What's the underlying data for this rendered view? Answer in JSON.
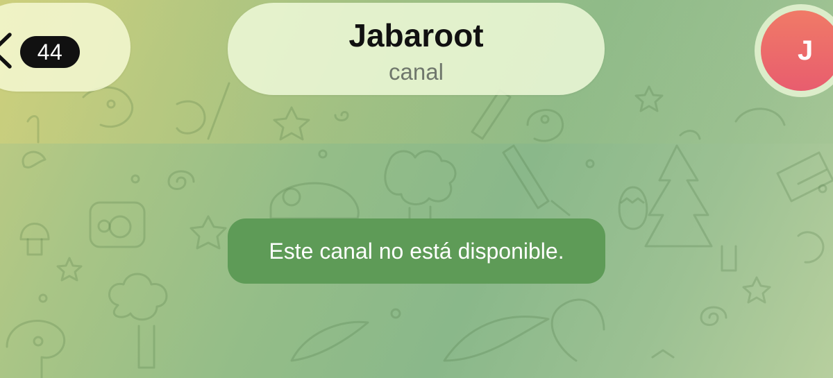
{
  "header": {
    "back": {
      "icon": "chevron-left-icon",
      "unread_count": "44"
    },
    "title": "Jabaroot",
    "subtitle": "canal",
    "avatar": {
      "initial": "J",
      "colors": [
        "#f07a67",
        "#e85d6e"
      ]
    }
  },
  "chat": {
    "service_message": "Este canal no está disponible.",
    "bubble_color": "#5e9b57",
    "wallpaper": "green-doodle-pattern"
  }
}
